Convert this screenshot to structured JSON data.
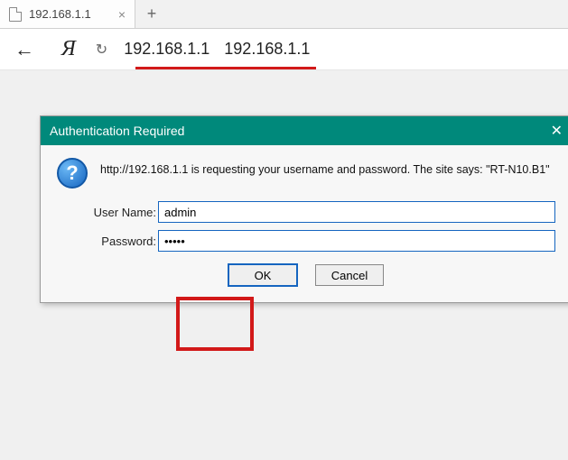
{
  "tab": {
    "title": "192.168.1.1"
  },
  "toolbar": {
    "address1": "192.168.1.1",
    "address2": "192.168.1.1"
  },
  "dialog": {
    "title": "Authentication Required",
    "message": "http://192.168.1.1 is requesting your username and password. The site says: \"RT-N10.B1\"",
    "username_label": "User Name:",
    "password_label": "Password:",
    "username_value": "admin",
    "password_value": "•••••",
    "ok_label": "OK",
    "cancel_label": "Cancel"
  }
}
